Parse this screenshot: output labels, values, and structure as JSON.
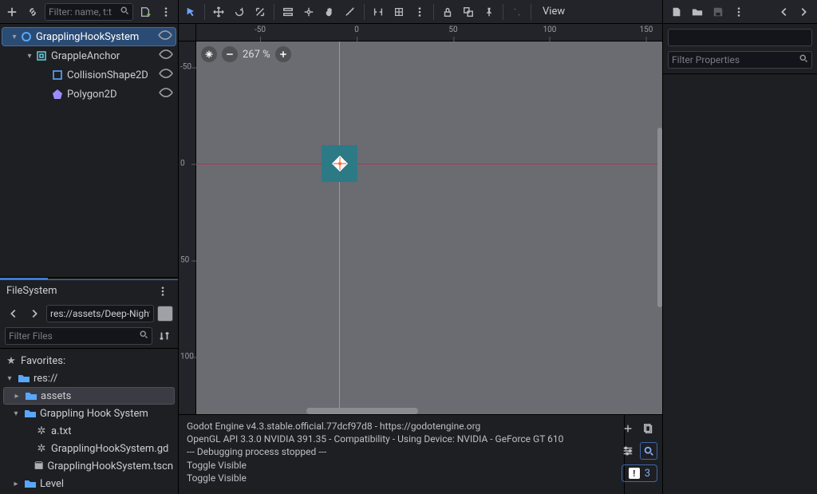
{
  "scene_toolbar": {
    "filter_placeholder": "Filter: name, t:t"
  },
  "scene_tree": {
    "nodes": [
      {
        "name": "GrapplingHookSystem"
      },
      {
        "name": "GrappleAnchor"
      },
      {
        "name": "CollisionShape2D"
      },
      {
        "name": "Polygon2D"
      }
    ]
  },
  "viewport_toolbar": {
    "view_label": "View"
  },
  "viewport": {
    "zoom_text": "267 %",
    "ruler_top": [
      "-50",
      "0",
      "50",
      "100",
      "150"
    ],
    "ruler_left": [
      "-50",
      "0",
      "50",
      "100"
    ]
  },
  "output": {
    "lines": [
      "Godot Engine v4.3.stable.official.77dcf97d8 - https://godotengine.org",
      "OpenGL API 3.3.0 NVIDIA 391.35 - Compatibility - Using Device: NVIDIA - GeForce GT 610",
      "",
      "--- Debugging process stopped ---",
      "Toggle Visible",
      "Toggle Visible"
    ],
    "error_count": "3"
  },
  "filesystem": {
    "title": "FileSystem",
    "path_value": "res://assets/Deep-Night/Til",
    "filter_placeholder": "Filter Files",
    "favorites_label": "Favorites:",
    "tree": {
      "root": "res://",
      "assets": "assets",
      "ghs": "Grappling Hook System",
      "a_txt": "a.txt",
      "gd": "GrapplingHookSystem.gd",
      "tscn": "GrapplingHookSystem.tscn",
      "level": "Level"
    }
  },
  "inspector": {
    "filter_placeholder": "Filter Properties"
  }
}
